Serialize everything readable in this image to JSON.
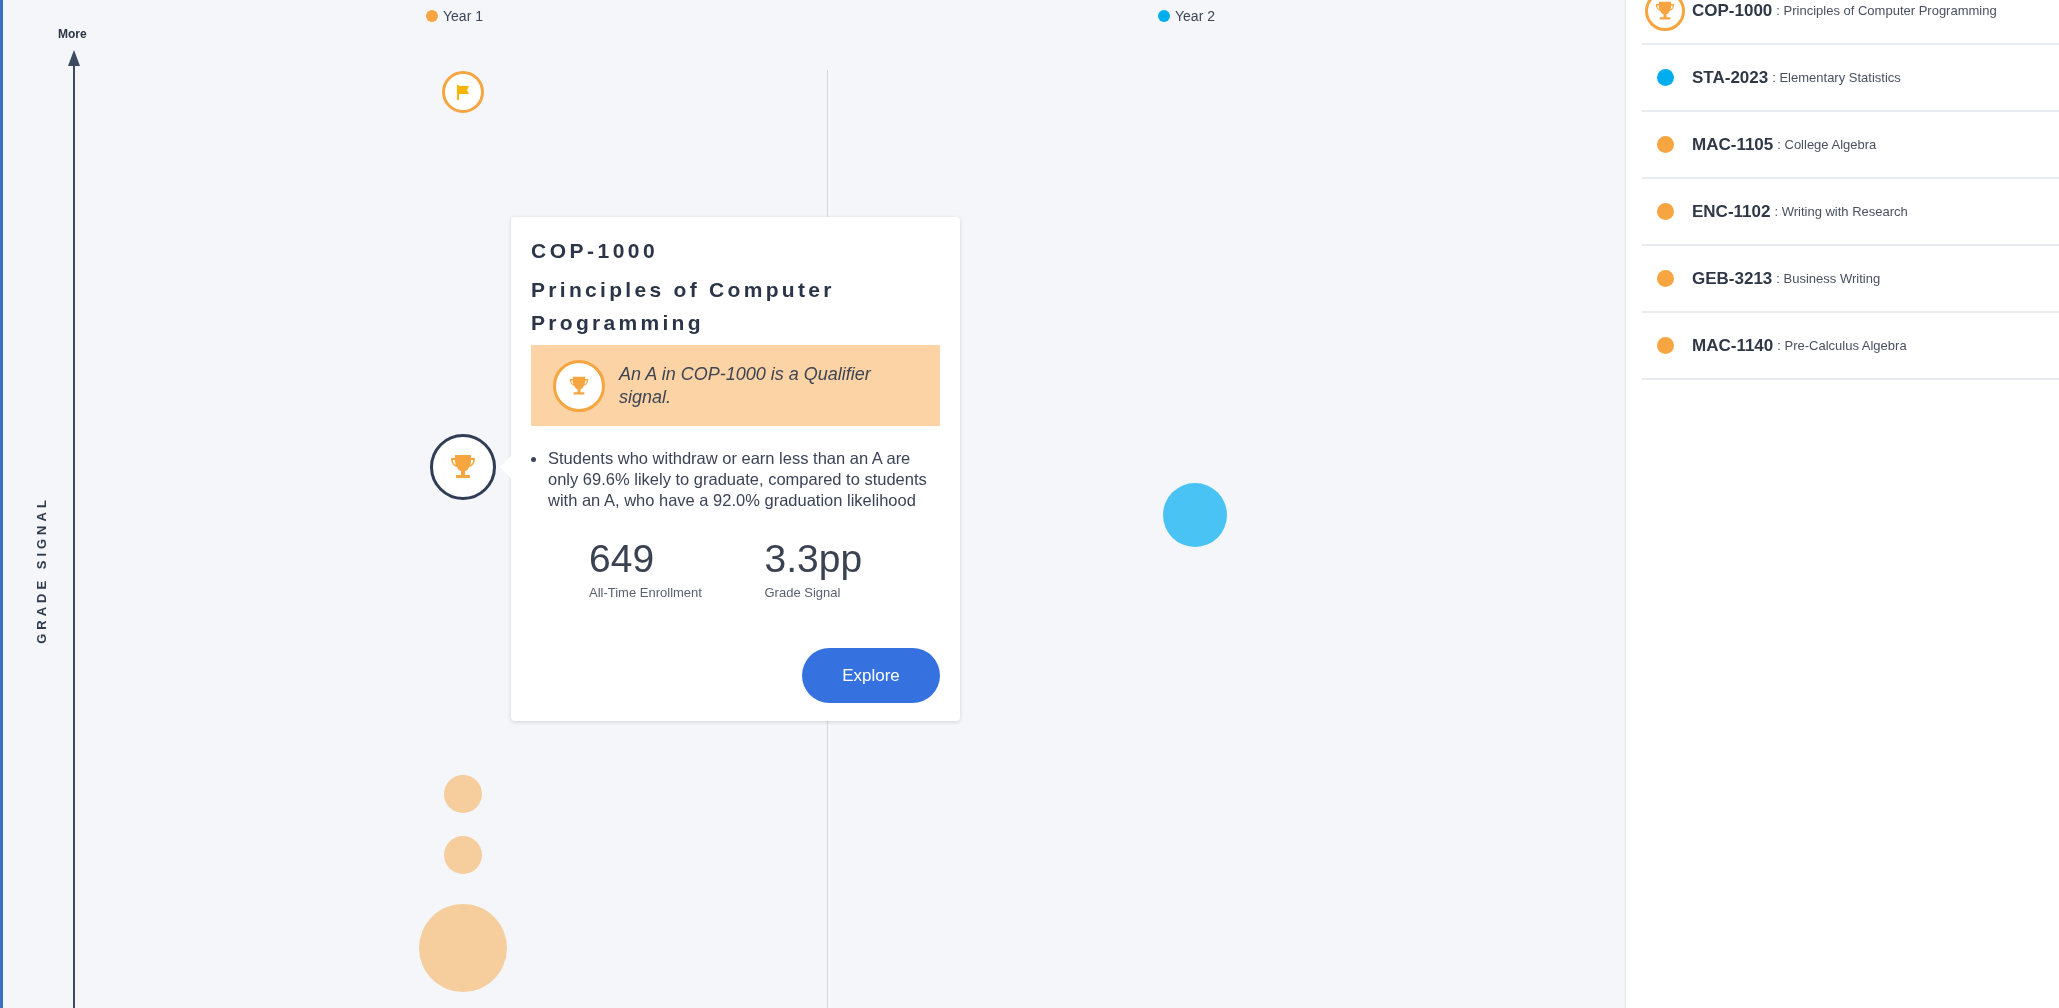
{
  "chart": {
    "axis_top_label": "More",
    "axis_title": "GRADE SIGNAL",
    "years": [
      {
        "label": "Year 1",
        "color": "#f7a540",
        "bubbles": [
          {
            "kind": "flag",
            "selected": false
          },
          {
            "kind": "trophy",
            "selected": true
          },
          {
            "kind": "plain",
            "selected": false
          },
          {
            "kind": "plain",
            "selected": false
          },
          {
            "kind": "plain",
            "selected": false
          }
        ]
      },
      {
        "label": "Year 2",
        "color": "#00aeef",
        "bubbles": [
          {
            "kind": "plain",
            "selected": false
          }
        ]
      }
    ]
  },
  "tooltip": {
    "code": "COP-1000",
    "title": "Principles of Computer Programming",
    "signal": "An A in COP-1000 is a Qualifier signal.",
    "bullets": [
      "Students who withdraw or earn less than an A are only 69.6% likely to graduate, compared to students with an A, who have a 92.0% graduation likelihood"
    ],
    "stats": [
      {
        "value": "649",
        "label": "All-Time Enrollment"
      },
      {
        "value": "3.3pp",
        "label": "Grade Signal"
      }
    ],
    "button": "Explore"
  },
  "courses": [
    {
      "kind": "trophy",
      "code": "COP-1000",
      "title": ": Principles of Computer Programming",
      "color": "#f7a540"
    },
    {
      "kind": "dot",
      "code": "STA-2023",
      "title": ": Elementary Statistics",
      "color": "#00aeef"
    },
    {
      "kind": "dot",
      "code": "MAC-1105",
      "title": ": College Algebra",
      "color": "#f7a540"
    },
    {
      "kind": "dot",
      "code": "ENC-1102",
      "title": ": Writing with Research",
      "color": "#f7a540"
    },
    {
      "kind": "dot",
      "code": "GEB-3213",
      "title": ": Business Writing",
      "color": "#f7a540"
    },
    {
      "kind": "dot",
      "code": "MAC-1140",
      "title": ": Pre-Calculus Algebra",
      "color": "#f7a540"
    }
  ]
}
